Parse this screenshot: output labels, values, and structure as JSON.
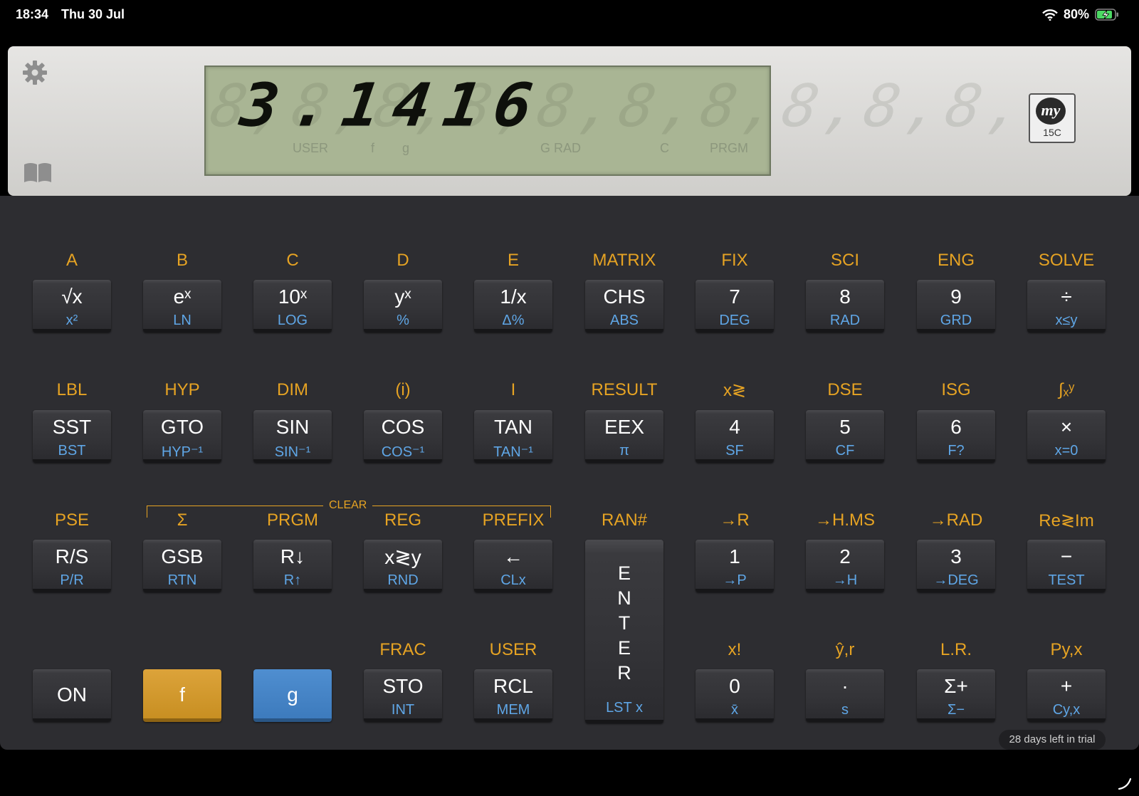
{
  "status_bar": {
    "time": "18:34",
    "date": "Thu 30 Jul",
    "battery": "80%"
  },
  "display": {
    "value": "3.1416",
    "ghost": "8,8,8,8,8,8,8,8,8,8,",
    "annunciators": {
      "user": "USER",
      "f": "f",
      "g": "g",
      "grad": "G RAD",
      "c": "C",
      "prgm": "PRGM"
    },
    "logo": {
      "mark": "my",
      "model": "15C"
    }
  },
  "rows": [
    {
      "gold": [
        "A",
        "B",
        "C",
        "D",
        "E",
        "MATRIX",
        "FIX",
        "SCI",
        "ENG",
        "SOLVE"
      ],
      "face": [
        "√x",
        "eˣ",
        "10ˣ",
        "yˣ",
        "1/x",
        "CHS",
        "7",
        "8",
        "9",
        "÷"
      ],
      "blue": [
        "x²",
        "LN",
        "LOG",
        "%",
        "Δ%",
        "ABS",
        "DEG",
        "RAD",
        "GRD",
        "x≤y"
      ]
    },
    {
      "gold": [
        "LBL",
        "HYP",
        "DIM",
        "(i)",
        "I",
        "RESULT",
        "x≷",
        "DSE",
        "ISG",
        "∫ₓʸ"
      ],
      "face": [
        "SST",
        "GTO",
        "SIN",
        "COS",
        "TAN",
        "EEX",
        "4",
        "5",
        "6",
        "×"
      ],
      "blue": [
        "BST",
        "HYP⁻¹",
        "SIN⁻¹",
        "COS⁻¹",
        "TAN⁻¹",
        "π",
        "SF",
        "CF",
        "F?",
        "x=0"
      ]
    },
    {
      "gold": [
        "PSE",
        "Σ",
        "PRGM",
        "REG",
        "PREFIX",
        "RAN#",
        "→R",
        "→H.MS",
        "→RAD",
        "Re≷Im"
      ],
      "face": [
        "R/S",
        "GSB",
        "R↓",
        "x≷y",
        "←",
        "",
        "1",
        "2",
        "3",
        "−"
      ],
      "blue": [
        "P/R",
        "RTN",
        "R↑",
        "RND",
        "CLx",
        "",
        "→P",
        "→H",
        "→DEG",
        "TEST"
      ]
    },
    {
      "gold": [
        "",
        "",
        "",
        "FRAC",
        "USER",
        "",
        "x!",
        "ŷ,r",
        "L.R.",
        "Py,x"
      ],
      "face": [
        "ON",
        "f",
        "g",
        "STO",
        "RCL",
        "",
        "0",
        "·",
        "Σ+",
        "+"
      ],
      "blue": [
        "",
        "",
        "",
        "INT",
        "MEM",
        "",
        "x̄",
        "s",
        "Σ−",
        "Cy,x"
      ]
    }
  ],
  "enter_key": {
    "letters": [
      "E",
      "N",
      "T",
      "E",
      "R"
    ],
    "blue": "LST x"
  },
  "clear_label": "CLEAR",
  "trial_text": "28 days left in trial"
}
